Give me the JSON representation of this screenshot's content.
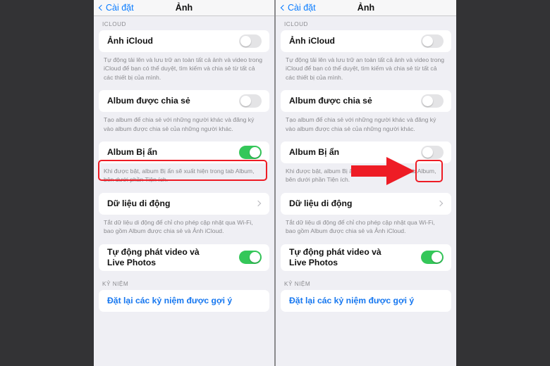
{
  "annotations": {
    "arrow_color": "#ee1c25",
    "highlight_color": "#ee1c25",
    "arrow_name": "red-arrow-pointing-to-toggle"
  },
  "colors": {
    "toggle_on": "#34c759",
    "toggle_off": "#e4e4e6",
    "accent_link": "#0a7cff",
    "page_background": "#efeff4",
    "outer_background": "#333335"
  },
  "nav": {
    "back_label": "Cài đặt",
    "title": "Ảnh"
  },
  "sections": {
    "icloud_header": "ICLOUD",
    "memories_header": "KỶ NIỆM"
  },
  "rows": {
    "icloud_photos": {
      "label": "Ảnh iCloud",
      "footnote": "Tự động tải lên và lưu trữ an toàn tất cả ảnh và video trong iCloud để bạn có thể duyệt, tìm kiếm và chia sẻ từ tất cả các thiết bị của mình.",
      "state_left": "off",
      "state_right": "off"
    },
    "shared_album": {
      "label": "Album được chia sẻ",
      "footnote": "Tạo album để chia sẻ với những người khác và đăng ký vào album được chia sẻ của những người khác.",
      "state_left": "off",
      "state_right": "off"
    },
    "hidden_album": {
      "label": "Album Bị ẩn",
      "footnote": "Khi được bật, album Bị ẩn sẽ xuất hiện trong tab Album, bên dưới phần Tiện ích.",
      "state_left": "on",
      "state_right": "off"
    },
    "cellular_data": {
      "label": "Dữ liệu di động",
      "footnote": "Tắt dữ liệu di động để chỉ cho phép cập nhật qua Wi-Fi, bao gồm Album được chia sẻ và Ảnh iCloud.",
      "accessory": "chevron-right"
    },
    "autoplay": {
      "label_line1": "Tự động phát video và",
      "label_line2": "Live Photos",
      "state_left": "on",
      "state_right": "on"
    },
    "reset_memories": {
      "label": "Đặt lại các kỷ niệm được gợi ý"
    }
  }
}
